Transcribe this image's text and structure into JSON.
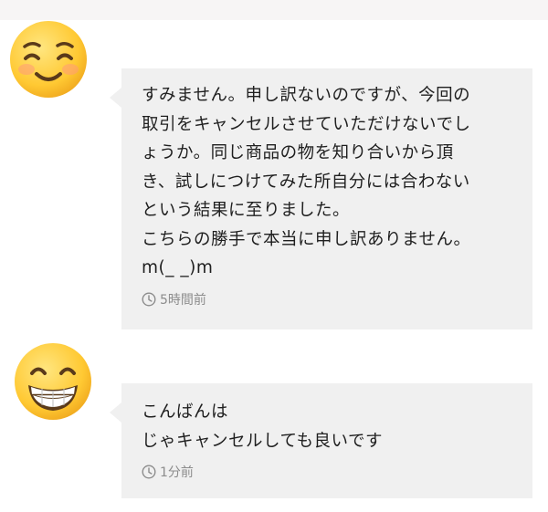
{
  "messages": [
    {
      "avatar_icon": "smiling-face-with-smiling-eyes-emoji",
      "lines": [
        "すみません。申し訳ないのですが、今回の",
        "取引をキャンセルさせていただけないでし",
        "ょうか。同じ商品の物を知り合いから頂",
        "き、試しにつけてみた所自分には合わない",
        "という結果に至りました。",
        "こちらの勝手で本当に申し訳ありません。",
        "m(_ _)m"
      ],
      "time": "5時間前"
    },
    {
      "avatar_icon": "grinning-face-emoji",
      "lines": [
        "こんばんは",
        "じゃキャンセルしても良いです"
      ],
      "time": "1分前"
    }
  ],
  "colors": {
    "bubble_bg": "#f0f0f0",
    "text": "#1f1f1f",
    "timestamp": "#8c8c8c",
    "emoji_yellow": "#ffcc33"
  }
}
